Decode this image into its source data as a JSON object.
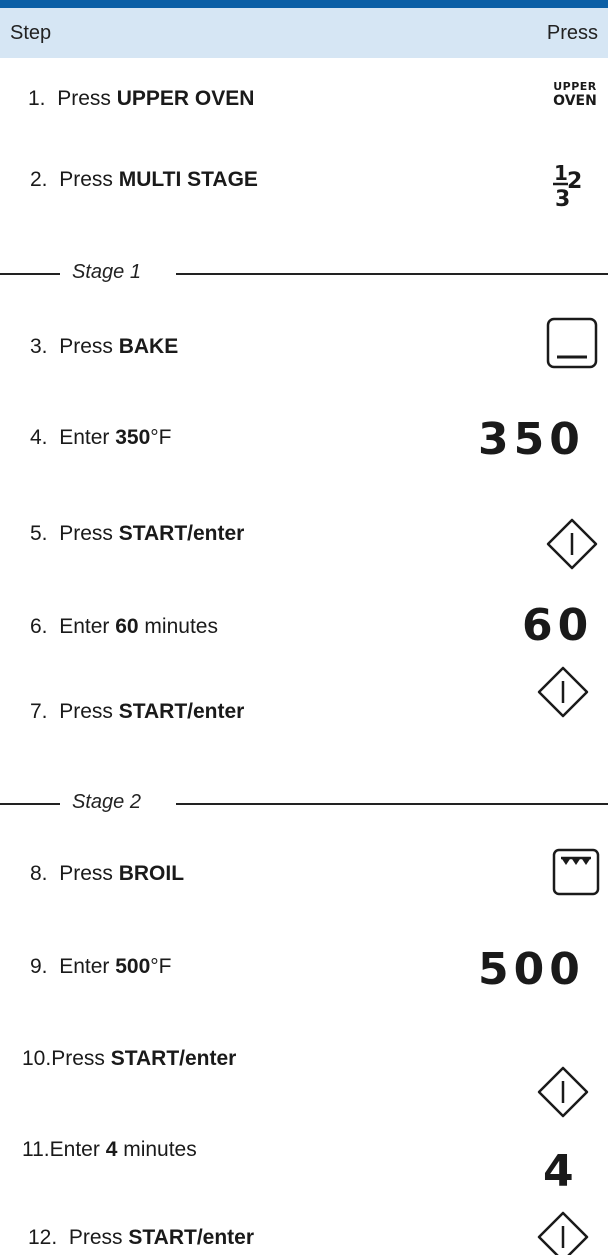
{
  "header": {
    "step_label": "Step",
    "press_label": "Press"
  },
  "steps": [
    {
      "num": "1.",
      "verb": "Press",
      "bold": "UPPER OVEN",
      "suffix": ""
    },
    {
      "num": "2.",
      "verb": "Press",
      "bold": "MULTI STAGE",
      "suffix": ""
    },
    {
      "num": "3.",
      "verb": "Press",
      "bold": "BAKE",
      "suffix": ""
    },
    {
      "num": "4.",
      "verb": "Enter",
      "bold": "350",
      "suffix": "°F"
    },
    {
      "num": "5.",
      "verb": "Press",
      "bold": "START/enter",
      "suffix": ""
    },
    {
      "num": "6.",
      "verb": "Enter",
      "bold": "60",
      "suffix": " minutes"
    },
    {
      "num": "7.",
      "verb": "Press",
      "bold": "START/enter",
      "suffix": ""
    },
    {
      "num": "8.",
      "verb": "Press",
      "bold": "BROIL",
      "suffix": ""
    },
    {
      "num": "9.",
      "verb": "Enter",
      "bold": "500",
      "suffix": "°F"
    },
    {
      "num": "10.",
      "verb": "Press",
      "bold": "START/enter",
      "suffix": ""
    },
    {
      "num": "11.",
      "verb": "Enter",
      "bold": "4",
      "suffix": " minutes"
    },
    {
      "num": "12.",
      "verb": "Press",
      "bold": "START/enter",
      "suffix": ""
    }
  ],
  "stages": {
    "stage1": "Stage 1",
    "stage2": "Stage 2"
  },
  "keys": {
    "upper_oven_line1": "UPPER",
    "upper_oven_line2": "OVEN",
    "multi_stage_1": "1",
    "multi_stage_2": "2",
    "multi_stage_3": "3",
    "temp_350": "350",
    "time_60": "60",
    "temp_500": "500",
    "time_4": "4"
  },
  "colors": {
    "top_bar": "#0b5fa6",
    "header_bg": "#d6e6f4"
  }
}
